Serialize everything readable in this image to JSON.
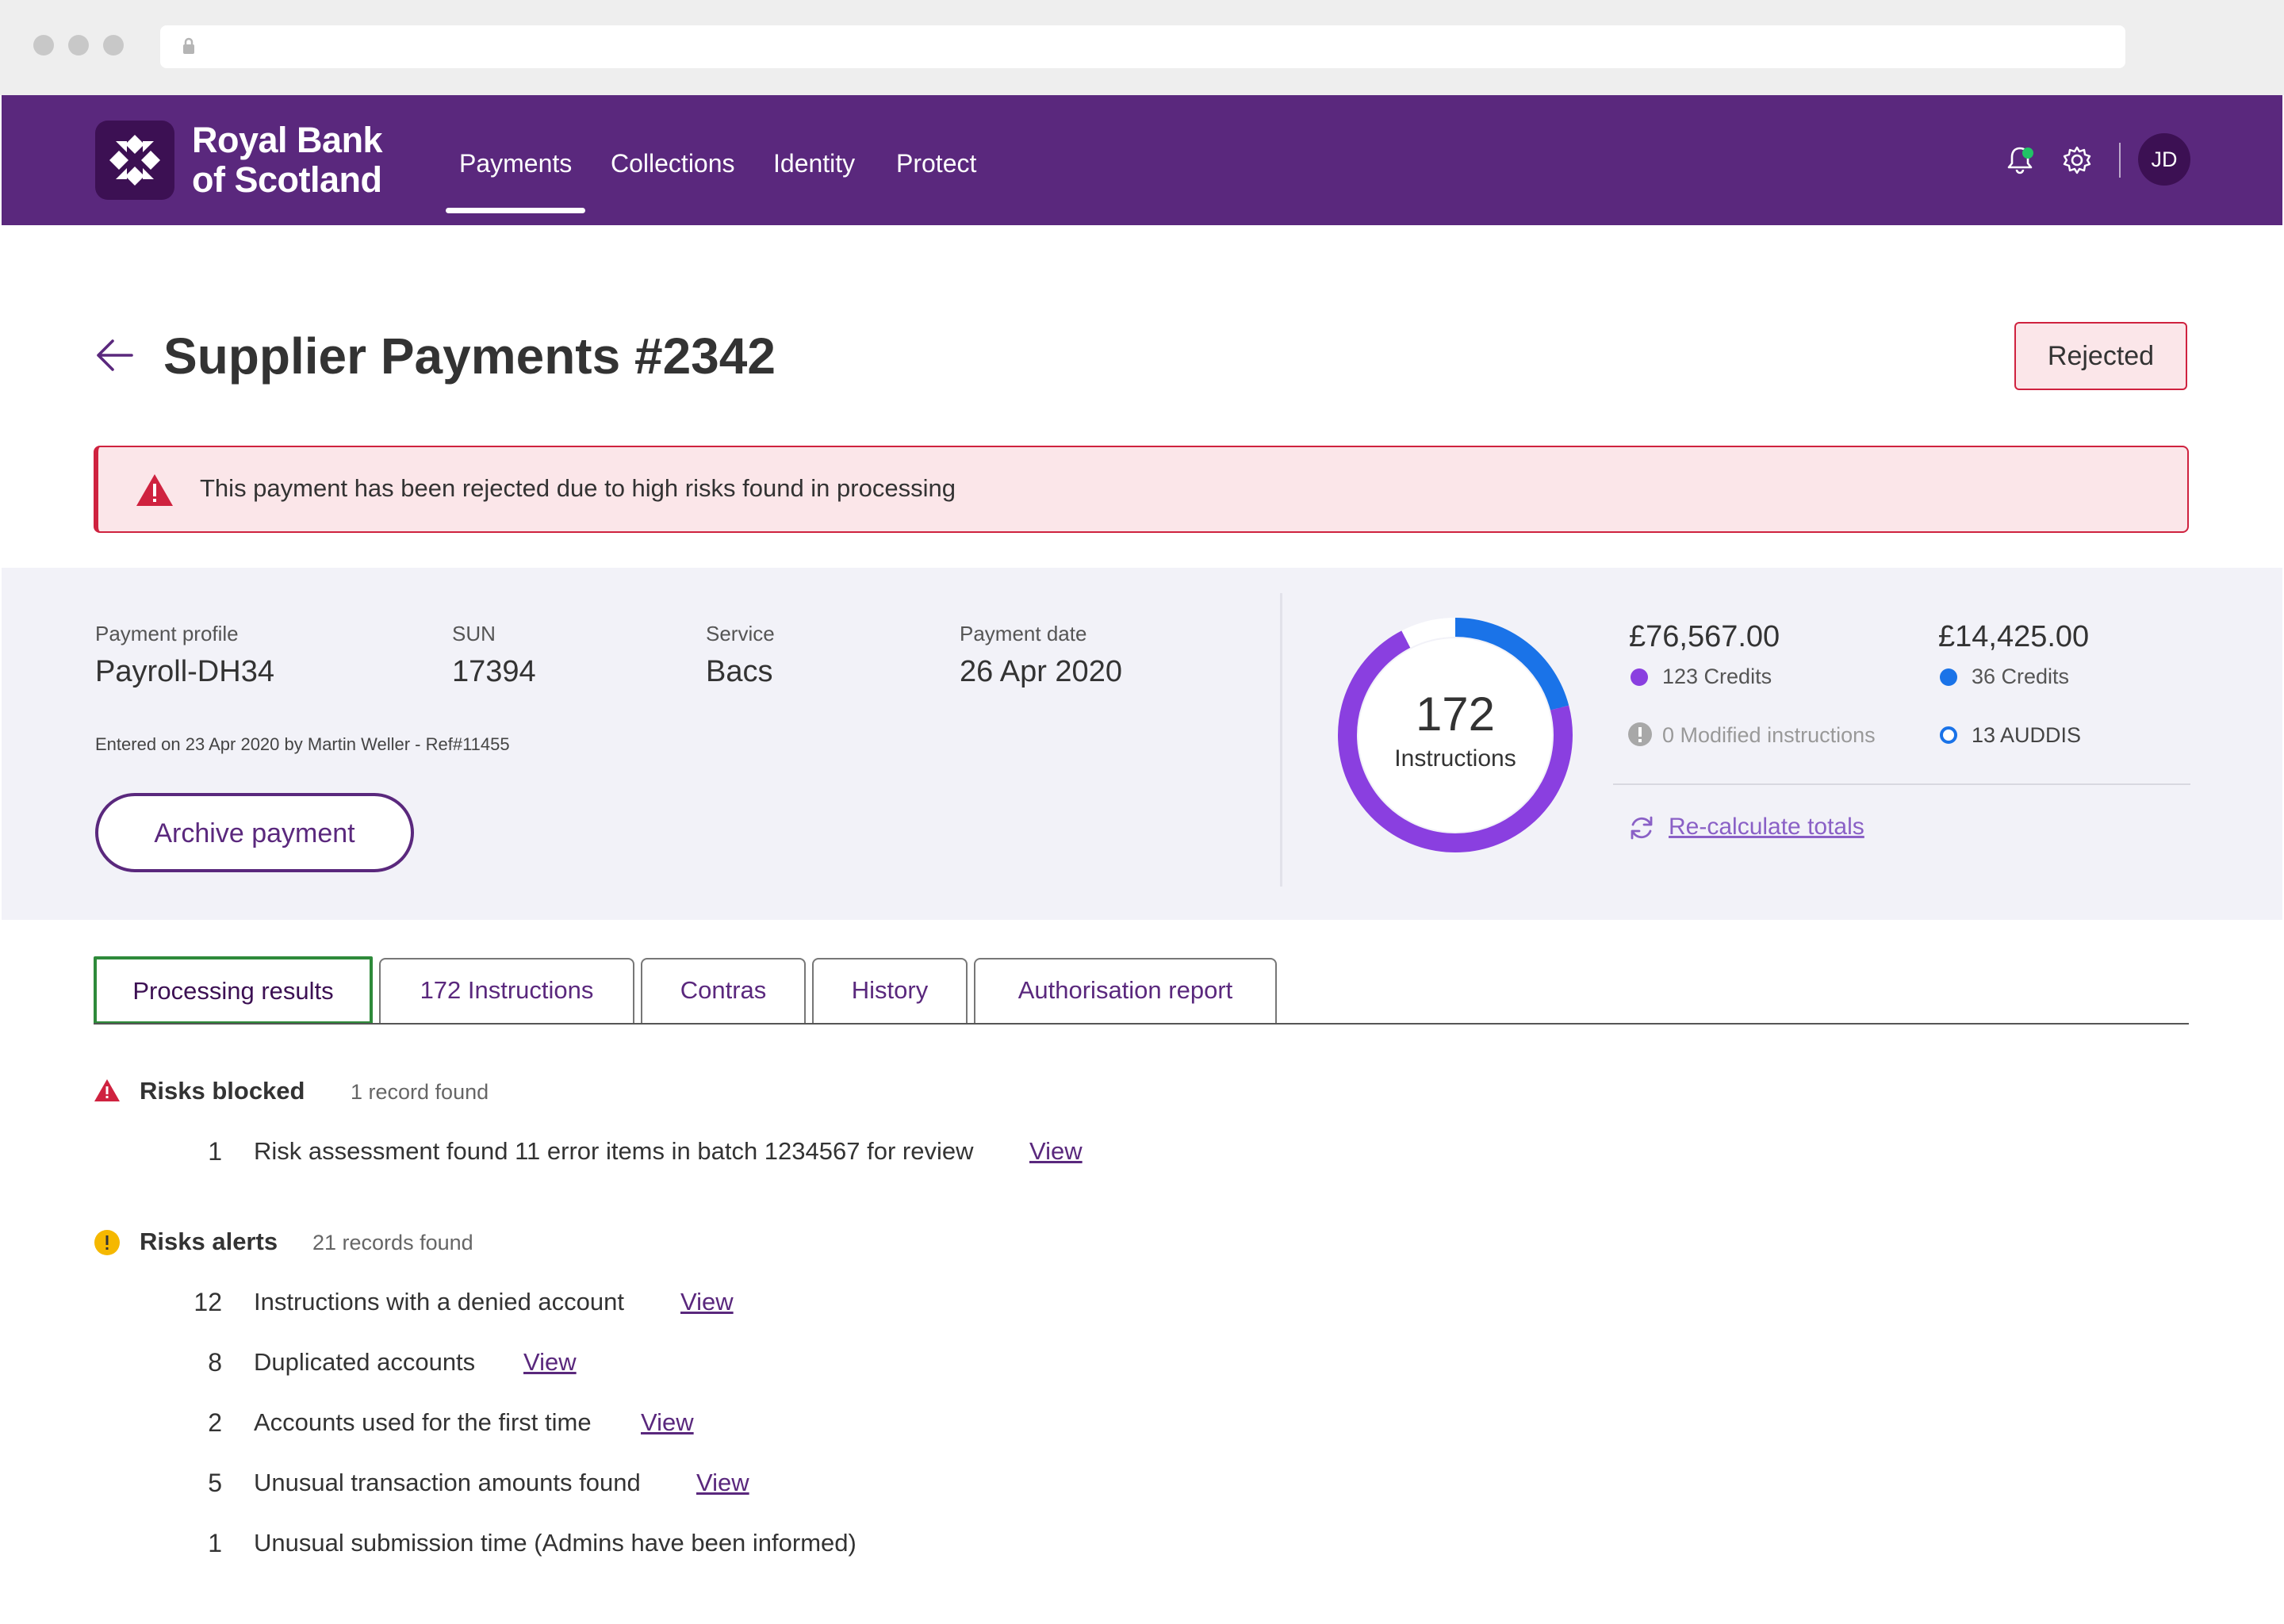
{
  "brand": {
    "name_line1": "Royal Bank",
    "name_line2": "of Scotland",
    "primary_color": "#5a287d",
    "dark_color": "#3c1053"
  },
  "nav": {
    "items": [
      {
        "label": "Payments",
        "active": true
      },
      {
        "label": "Collections",
        "active": false
      },
      {
        "label": "Identity",
        "active": false
      },
      {
        "label": "Protect",
        "active": false
      }
    ],
    "icons": [
      "bell-icon",
      "gear-icon"
    ],
    "user_initials": "JD"
  },
  "page": {
    "title": "Supplier Payments #2342",
    "status": "Rejected",
    "alert": "This payment has been rejected due to high risks found in processing"
  },
  "summary": {
    "fields": [
      {
        "label": "Payment profile",
        "value": "Payroll-DH34"
      },
      {
        "label": "SUN",
        "value": "17394"
      },
      {
        "label": "Service",
        "value": "Bacs"
      },
      {
        "label": "Payment date",
        "value": "26 Apr 2020"
      }
    ],
    "entered": "Entered on 23 Apr 2020 by Martin Weller - Ref#11455",
    "archive_label": "Archive payment",
    "donut": {
      "total": "172",
      "label": "Instructions",
      "segments": [
        {
          "name": "Credits",
          "value": 123,
          "color": "#8a3fe0"
        },
        {
          "name": "Credits",
          "value": 36,
          "color": "#1a73e8"
        },
        {
          "name": "AUDDIS",
          "value": 13,
          "color": "#ffffff"
        }
      ]
    },
    "totals": [
      {
        "amount": "£76,567.00",
        "legend": "123 Credits",
        "color": "#8a3fe0"
      },
      {
        "amount": "£14,425.00",
        "legend": "36 Credits",
        "color": "#1a73e8"
      }
    ],
    "modified": "0 Modified instructions",
    "auddis": "13 AUDDIS",
    "recalc": "Re-calculate totals"
  },
  "tabs": [
    {
      "label": "Processing results",
      "active": true
    },
    {
      "label": "172 Instructions",
      "active": false
    },
    {
      "label": "Contras",
      "active": false
    },
    {
      "label": "History",
      "active": false
    },
    {
      "label": "Authorisation report",
      "active": false
    }
  ],
  "results": {
    "blocked": {
      "title": "Risks blocked",
      "count": "1 record found",
      "rows": [
        {
          "num": "1",
          "text": "Risk assessment found 11 error items in batch 1234567 for review",
          "link": "View"
        }
      ]
    },
    "alerts": {
      "title": "Risks alerts",
      "count": "21 records found",
      "rows": [
        {
          "num": "12",
          "text": "Instructions with a denied account",
          "link": "View"
        },
        {
          "num": "8",
          "text": "Duplicated accounts",
          "link": "View"
        },
        {
          "num": "2",
          "text": "Accounts used for the first time",
          "link": "View"
        },
        {
          "num": "5",
          "text": "Unusual transaction amounts found",
          "link": "View"
        },
        {
          "num": "1",
          "text": "Unusual submission time (Admins have been informed)",
          "link": ""
        }
      ]
    }
  }
}
